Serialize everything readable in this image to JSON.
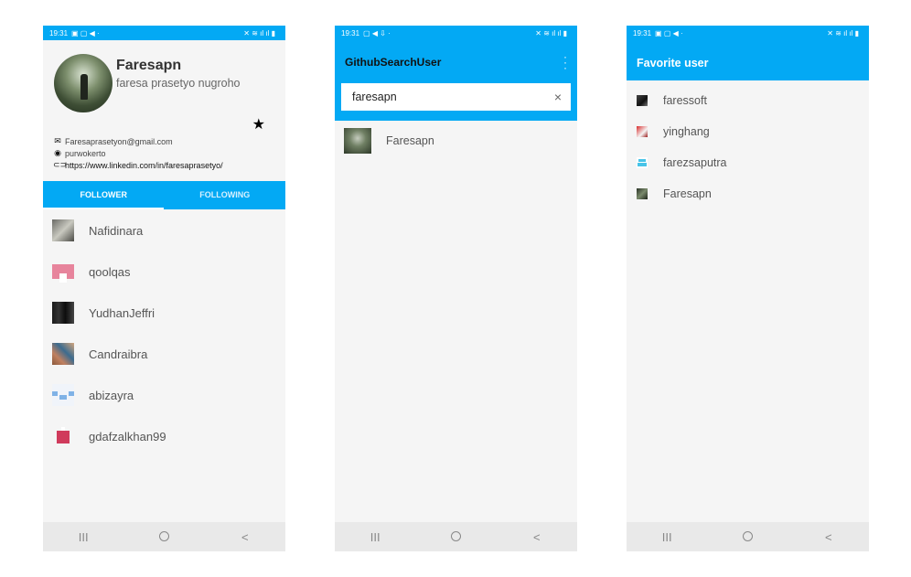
{
  "status_time": "19:31",
  "profile_screen": {
    "username": "Faresapn",
    "fullname": "faresa prasetyo nugroho",
    "email": "Faresaprasetyon@gmail.com",
    "location": "purwokerto",
    "link": "https://www.linkedin.com/in/faresaprasetyo/",
    "favorite_icon": "star-icon",
    "tabs": [
      "FOLLOWER",
      "FOLLOWING"
    ],
    "followers": [
      "Nafidinara",
      "qoolqas",
      "YudhanJeffri",
      "Candraibra",
      "abizayra",
      "gdafzalkhan99"
    ]
  },
  "search_screen": {
    "title": "GithubSearchUser",
    "query": "faresapn",
    "clear_icon": "×",
    "results": [
      "Faresapn"
    ]
  },
  "favorite_screen": {
    "title": "Favorite user",
    "users": [
      "faressoft",
      "yinghang",
      "farezsaputra",
      "Faresapn"
    ]
  },
  "nav": {
    "recents": "III",
    "back": "<"
  },
  "colors": {
    "accent": "#03a9f4",
    "background": "#f5f5f5"
  }
}
